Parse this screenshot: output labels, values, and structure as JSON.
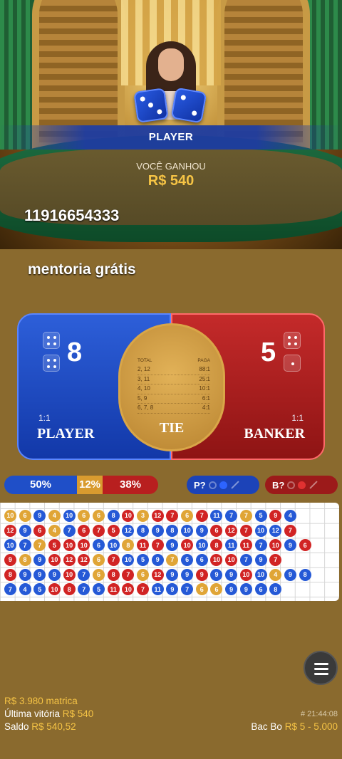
{
  "scene": {
    "win_side_label": "PLAYER",
    "win_message": "VOCÊ GANHOU",
    "win_amount": "R$ 540"
  },
  "overlay": {
    "phone": "11916654333",
    "promo": "mentoria grátis"
  },
  "board": {
    "player": {
      "score": "8",
      "ratio": "1:1",
      "label": "PLAYER"
    },
    "banker": {
      "score": "5",
      "ratio": "1:1",
      "label": "BANKER"
    },
    "tie": {
      "label": "TIE",
      "header_left": "TOTAL",
      "header_right": "PAGA",
      "rows": [
        {
          "total": "2, 12",
          "pay": "88:1"
        },
        {
          "total": "3, 11",
          "pay": "25:1"
        },
        {
          "total": "4, 10",
          "pay": "10:1"
        },
        {
          "total": "5, 9",
          "pay": "6:1"
        },
        {
          "total": "6, 7, 8",
          "pay": "4:1"
        }
      ]
    }
  },
  "stats": {
    "player_pct": "50%",
    "tie_pct": "12%",
    "banker_pct": "38%"
  },
  "predict": {
    "player_label": "P?",
    "banker_label": "B?"
  },
  "roadmap": [
    [
      [
        "Y",
        "10"
      ],
      [
        "Y",
        "6"
      ],
      [
        "B",
        "9"
      ],
      [
        "Y",
        "4"
      ],
      [
        "B",
        "10"
      ],
      [
        "Y",
        "6"
      ],
      [
        "Y",
        "6"
      ],
      [
        "B",
        "8"
      ],
      [
        "R",
        "10"
      ],
      [
        "Y",
        "3"
      ],
      [
        "R",
        "12"
      ],
      [
        "R",
        "7"
      ],
      [
        "Y",
        "6"
      ],
      [
        "R",
        "7"
      ],
      [
        "B",
        "11"
      ],
      [
        "B",
        "7"
      ],
      [
        "Y",
        "7"
      ],
      [
        "B",
        "5"
      ],
      [
        "R",
        "9"
      ],
      [
        "B",
        "4"
      ]
    ],
    [
      [
        "R",
        "12"
      ],
      [
        "B",
        "9"
      ],
      [
        "R",
        "6"
      ],
      [
        "Y",
        "4"
      ],
      [
        "B",
        "7"
      ],
      [
        "R",
        "6"
      ],
      [
        "R",
        "7"
      ],
      [
        "R",
        "5"
      ],
      [
        "B",
        "12"
      ],
      [
        "B",
        "8"
      ],
      [
        "B",
        "9"
      ],
      [
        "B",
        "8"
      ],
      [
        "B",
        "10"
      ],
      [
        "B",
        "9"
      ],
      [
        "R",
        "6"
      ],
      [
        "R",
        "12"
      ],
      [
        "R",
        "7"
      ],
      [
        "B",
        "10"
      ],
      [
        "B",
        "12"
      ],
      [
        "R",
        "7"
      ]
    ],
    [
      [
        "B",
        "10"
      ],
      [
        "B",
        "7"
      ],
      [
        "Y",
        "7"
      ],
      [
        "R",
        "5"
      ],
      [
        "R",
        "10"
      ],
      [
        "R",
        "10"
      ],
      [
        "B",
        "6"
      ],
      [
        "B",
        "10"
      ],
      [
        "Y",
        "8"
      ],
      [
        "R",
        "11"
      ],
      [
        "R",
        "7"
      ],
      [
        "B",
        "9"
      ],
      [
        "R",
        "10"
      ],
      [
        "B",
        "10"
      ],
      [
        "R",
        "8"
      ],
      [
        "B",
        "11"
      ],
      [
        "R",
        "11"
      ],
      [
        "B",
        "7"
      ],
      [
        "R",
        "10"
      ],
      [
        "B",
        "9"
      ],
      [
        "R",
        "6"
      ]
    ],
    [
      [
        "R",
        "9"
      ],
      [
        "Y",
        "8"
      ],
      [
        "B",
        "9"
      ],
      [
        "R",
        "10"
      ],
      [
        "R",
        "12"
      ],
      [
        "R",
        "12"
      ],
      [
        "Y",
        "6"
      ],
      [
        "R",
        "7"
      ],
      [
        "B",
        "10"
      ],
      [
        "B",
        "5"
      ],
      [
        "B",
        "9"
      ],
      [
        "Y",
        "7"
      ],
      [
        "B",
        "6"
      ],
      [
        "B",
        "6"
      ],
      [
        "R",
        "10"
      ],
      [
        "R",
        "10"
      ],
      [
        "B",
        "7"
      ],
      [
        "B",
        "9"
      ],
      [
        "R",
        "7"
      ]
    ],
    [
      [
        "R",
        "8"
      ],
      [
        "B",
        "9"
      ],
      [
        "B",
        "9"
      ],
      [
        "B",
        "9"
      ],
      [
        "R",
        "10"
      ],
      [
        "B",
        "7"
      ],
      [
        "Y",
        "6"
      ],
      [
        "R",
        "8"
      ],
      [
        "R",
        "7"
      ],
      [
        "Y",
        "6"
      ],
      [
        "R",
        "12"
      ],
      [
        "B",
        "9"
      ],
      [
        "B",
        "9"
      ],
      [
        "R",
        "9"
      ],
      [
        "B",
        "9"
      ],
      [
        "B",
        "9"
      ],
      [
        "R",
        "10"
      ],
      [
        "B",
        "10"
      ],
      [
        "Y",
        "4"
      ],
      [
        "B",
        "9"
      ],
      [
        "B",
        "8"
      ]
    ],
    [
      [
        "B",
        "7"
      ],
      [
        "B",
        "4"
      ],
      [
        "B",
        "5"
      ],
      [
        "R",
        "10"
      ],
      [
        "R",
        "8"
      ],
      [
        "B",
        "7"
      ],
      [
        "B",
        "5"
      ],
      [
        "R",
        "11"
      ],
      [
        "R",
        "10"
      ],
      [
        "R",
        "7"
      ],
      [
        "B",
        "11"
      ],
      [
        "B",
        "9"
      ],
      [
        "B",
        "7"
      ],
      [
        "Y",
        "6"
      ],
      [
        "Y",
        "6"
      ],
      [
        "B",
        "9"
      ],
      [
        "B",
        "9"
      ],
      [
        "B",
        "6"
      ],
      [
        "B",
        "8"
      ]
    ]
  ],
  "footer": {
    "jackpot": "R$ 3.980 matrica",
    "last_win_label": "Última vitória",
    "last_win_value": "R$ 540",
    "balance_label": "Saldo",
    "balance_value": "R$ 540,52",
    "round_id": "# 21:44:08",
    "game_name": "Bac Bo",
    "limits": "R$ 5 - 5.000"
  },
  "icons": {
    "menu": "hamburger-menu-icon",
    "dice": "dice-icon"
  },
  "colors": {
    "player": "#1f4fc8",
    "banker": "#b81f1f",
    "tie": "#d99b2f",
    "win_amount": "#f6c445"
  }
}
